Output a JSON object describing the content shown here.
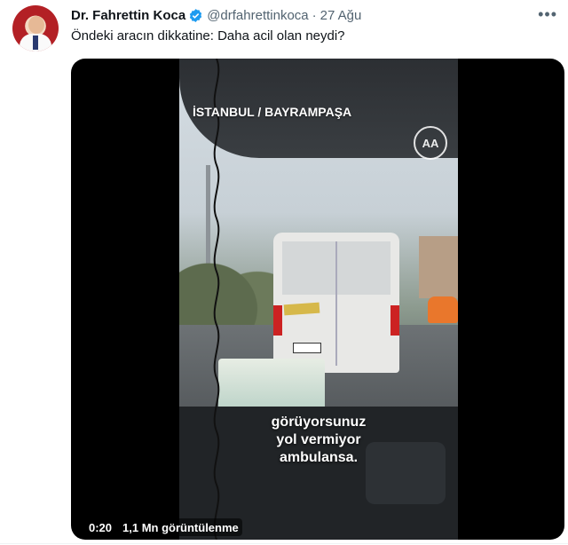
{
  "tweet": {
    "author_name": "Dr. Fahrettin Koca",
    "handle": "@drfahrettinkoca",
    "separator": "·",
    "timestamp": "27 Ağu",
    "more_icon": "more-horizontal-icon",
    "verified_icon": "verified-badge-icon",
    "verified_color": "#1d9bf0",
    "text": "Öndeki aracın dikkatine: Daha acil olan neydi?"
  },
  "video": {
    "location_caption": "İSTANBUL / BAYRAMPAŞA",
    "agency_logo": "AA",
    "subtitle_lines": [
      "görüyorsunuz",
      "yol vermiyor",
      "ambulansa."
    ],
    "elapsed": "0:20",
    "views": "1,1 Mn görüntülenme"
  }
}
